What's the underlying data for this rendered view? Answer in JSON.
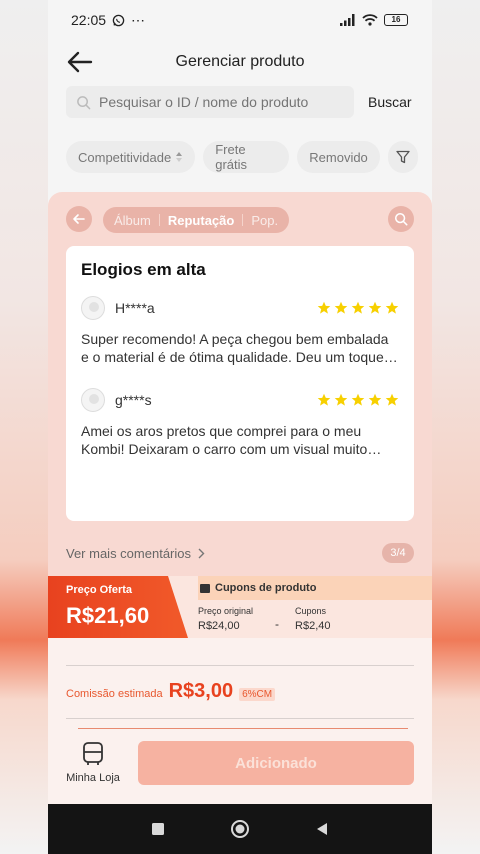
{
  "status_bar": {
    "time": "22:05",
    "notif_icons": "⋯",
    "battery": "16"
  },
  "header": {
    "title": "Gerenciar produto"
  },
  "search": {
    "placeholder": "Pesquisar o ID / nome do produto",
    "button_label": "Buscar"
  },
  "filters": [
    {
      "label": "Competitividade"
    },
    {
      "label": "Frete grátis"
    },
    {
      "label": "Removido"
    }
  ],
  "overlay": {
    "tabs": [
      "Álbum",
      "Reputação",
      "Pop."
    ],
    "card_title": "Elogios em alta",
    "reviews": [
      {
        "user": "H****a",
        "stars": 5,
        "text": "Super recomendo! A peça chegou bem embalada e o material é de ótima qualidade. Deu um toque especial no carro."
      },
      {
        "user": "g****s",
        "stars": 5,
        "text": "Amei os aros pretos que comprei para o meu Kombi! Deixaram o carro com um visual muito mais bonito."
      }
    ],
    "more_label": "Ver mais comentários",
    "page_indicator": "3/4"
  },
  "price": {
    "offer_label": "Preço Oferta",
    "offer_value": "R$21,60",
    "coupons_title": "Cupons de produto",
    "original_label": "Preço original",
    "original_value": "R$24,00",
    "minus": "-",
    "coupon_label": "Cupons",
    "coupon_value": "R$2,40"
  },
  "commission": {
    "label": "Comissão estimada",
    "value": "R$3,00",
    "badge": "6%CM"
  },
  "footer": {
    "shop_label": "Minha Loja",
    "add_button": "Adicionado"
  },
  "colors": {
    "accent": "#e8421f",
    "overlay": "#f8d9d2",
    "star": "#f7d000"
  }
}
